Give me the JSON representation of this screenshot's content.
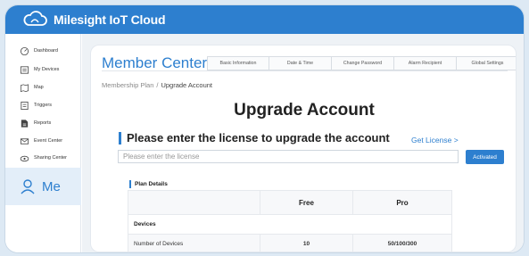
{
  "app": {
    "title": "Milesight IoT Cloud",
    "logo_icon": "cloud-logo-icon"
  },
  "sidebar": {
    "items": [
      {
        "label": "Dashboard",
        "icon": "dashboard-icon"
      },
      {
        "label": "My Devices",
        "icon": "devices-icon"
      },
      {
        "label": "Map",
        "icon": "map-icon"
      },
      {
        "label": "Triggers",
        "icon": "triggers-icon"
      },
      {
        "label": "Reports",
        "icon": "reports-icon"
      },
      {
        "label": "Event Center",
        "icon": "event-center-icon"
      },
      {
        "label": "Sharing Center",
        "icon": "sharing-center-icon"
      }
    ],
    "me": {
      "label": "Me",
      "icon": "user-icon"
    }
  },
  "member_center": {
    "title": "Member Center",
    "tabs": [
      {
        "label": "Basic Information"
      },
      {
        "label": "Date & Time"
      },
      {
        "label": "Change Password"
      },
      {
        "label": "Alarm Recipient"
      },
      {
        "label": "Global Settings"
      }
    ]
  },
  "breadcrumb": {
    "parent": "Membership Plan",
    "separator": "/",
    "current": "Upgrade Account"
  },
  "page_title": "Upgrade Account",
  "license": {
    "heading": "Please enter the license to upgrade the account",
    "get_license_link": "Get License >",
    "input_value": "",
    "input_placeholder": "Please enter the license",
    "activate_button": "Activated"
  },
  "plan_details": {
    "heading": "Plan Details",
    "columns": [
      "",
      "Free",
      "Pro"
    ],
    "group": "Devices",
    "rows": [
      {
        "name": "Number of Devices",
        "free": "10",
        "pro": "50/100/300"
      }
    ]
  },
  "colors": {
    "accent": "#2d7fcf",
    "page_bg": "#eef2f6",
    "active_nav_bg": "#e3eef9"
  }
}
